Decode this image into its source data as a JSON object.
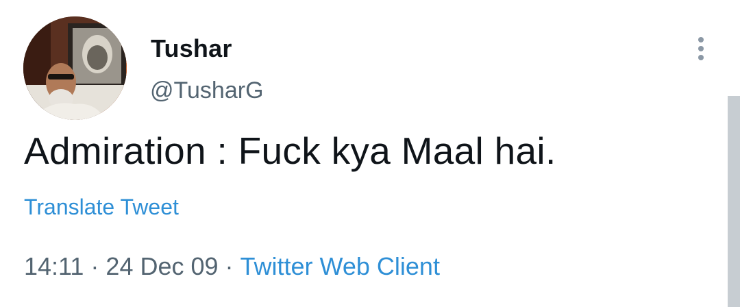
{
  "user": {
    "display_name": "Tushar",
    "handle": "@TusharG"
  },
  "tweet": {
    "text": "Admiration : Fuck kya Maal hai.",
    "translate_label": "Translate Tweet",
    "time": "14:11",
    "date": "24 Dec 09",
    "client": "Twitter Web Client",
    "separator": "·"
  },
  "icons": {
    "more": "more-vertical-icon",
    "avatar": "profile-photo"
  },
  "colors": {
    "text": "#0f1419",
    "secondary": "#536471",
    "link": "#2e8fd6"
  }
}
